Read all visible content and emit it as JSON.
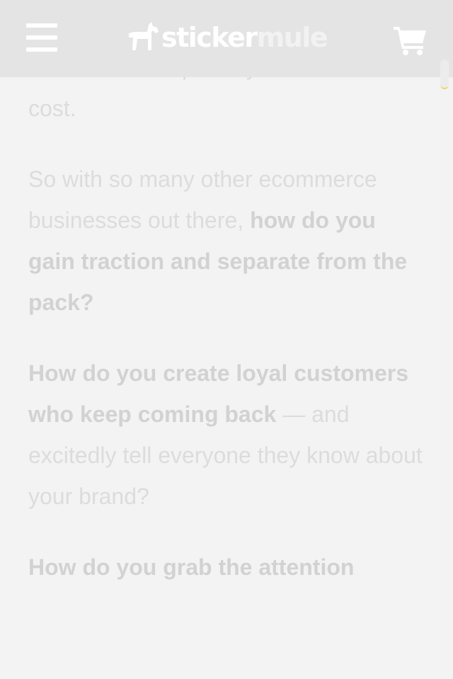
{
  "header": {
    "menu_icon": "hamburger-menu-icon",
    "logo": {
      "part1": "sticker",
      "part2": "mule",
      "mark_icon": "mule-icon"
    },
    "cart_icon": "shopping-cart-icon"
  },
  "article": {
    "p1_clipped": "comes at an especially massive",
    "p1_end": "cost.",
    "p2_plain": "So with so many other ecommerce businesses out there,",
    "p2_bold": "how do you gain traction and separate from the pack?",
    "p3_bold": "How do you create loyal customers who keep coming back",
    "p3_plain": " — and excitedly tell everyone they know about your brand?",
    "p4_bold": "How do you grab the attention"
  },
  "colors": {
    "header_bg": "#e4e4e4",
    "page_bg": "#f3f3f3",
    "text": "#dcdcdc"
  }
}
